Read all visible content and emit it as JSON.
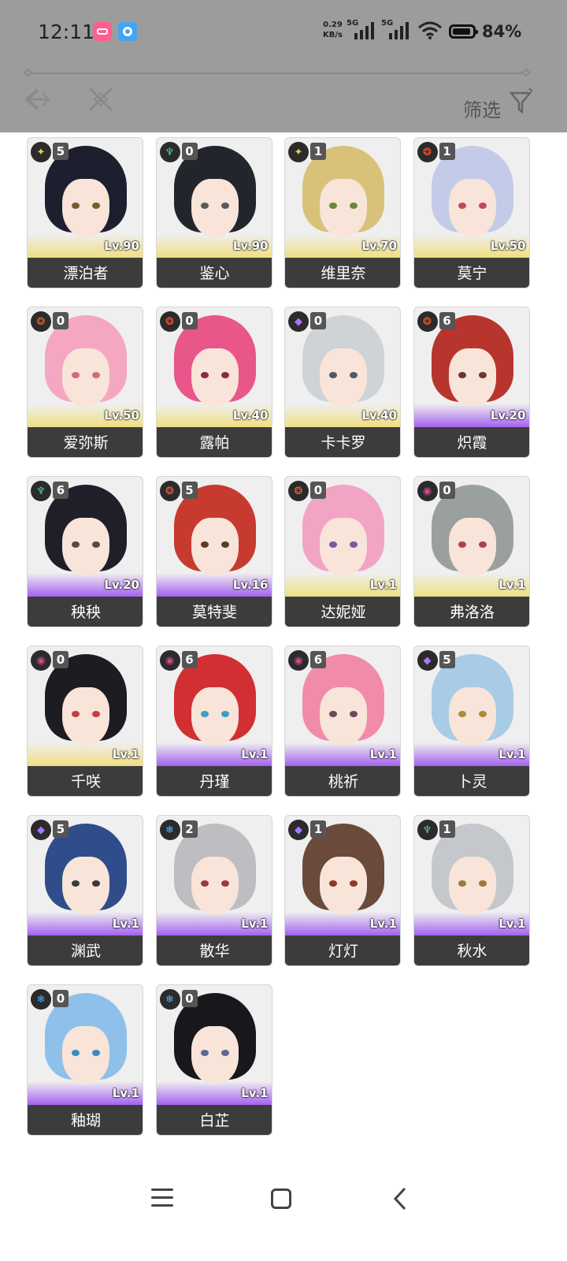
{
  "status_bar": {
    "time": "12:11",
    "net_speed_value": "0.29",
    "net_speed_unit": "KB/s",
    "sim1": "5G",
    "sim2": "5G",
    "battery": "84%"
  },
  "toolbar": {
    "filter_label": "筛选"
  },
  "colors": {
    "overlay": "#9c9c9c",
    "name_bar": "#3c3c3c",
    "rarity5": "#f0dc6e",
    "rarity4": "#a05af0"
  },
  "characters": [
    {
      "name": "漂泊者",
      "level": "Lv.90",
      "cons": "5",
      "element": "spectro-icon",
      "rarity": 5,
      "hair": "#1d1f2e",
      "eye": "#7a5a30"
    },
    {
      "name": "鉴心",
      "level": "Lv.90",
      "cons": "0",
      "element": "aero-icon",
      "rarity": 5,
      "hair": "#23252c",
      "eye": "#5a5a5a"
    },
    {
      "name": "维里奈",
      "level": "Lv.70",
      "cons": "1",
      "element": "spectro-icon",
      "rarity": 5,
      "hair": "#d8c27a",
      "eye": "#6a8a3a"
    },
    {
      "name": "莫宁",
      "level": "Lv.50",
      "cons": "1",
      "element": "fusion-icon",
      "rarity": 5,
      "hair": "#c4cbe8",
      "eye": "#c04a5a"
    },
    {
      "name": "爱弥斯",
      "level": "Lv.50",
      "cons": "0",
      "element": "fusion-icon",
      "rarity": 5,
      "hair": "#f5a6c0",
      "eye": "#d06a7a"
    },
    {
      "name": "露帕",
      "level": "Lv.40",
      "cons": "0",
      "element": "fusion-icon",
      "rarity": 5,
      "hair": "#e8568a",
      "eye": "#8a2a4a"
    },
    {
      "name": "卡卡罗",
      "level": "Lv.40",
      "cons": "0",
      "element": "electro-icon",
      "rarity": 5,
      "hair": "#cfd2d6",
      "eye": "#4a5a6a"
    },
    {
      "name": "炽霞",
      "level": "Lv.20",
      "cons": "6",
      "element": "fusion-icon",
      "rarity": 4,
      "hair": "#b8352e",
      "eye": "#6a3a2a"
    },
    {
      "name": "秧秧",
      "level": "Lv.20",
      "cons": "6",
      "element": "aero-icon",
      "rarity": 4,
      "hair": "#1f1f2a",
      "eye": "#5a4a3a"
    },
    {
      "name": "莫特斐",
      "level": "Lv.16",
      "cons": "5",
      "element": "fusion-icon",
      "rarity": 4,
      "hair": "#c63a30",
      "eye": "#5a3a2a"
    },
    {
      "name": "达妮娅",
      "level": "Lv.1",
      "cons": "0",
      "element": "fusion-icon",
      "rarity": 5,
      "hair": "#f2a4c4",
      "eye": "#7a5aa0"
    },
    {
      "name": "弗洛洛",
      "level": "Lv.1",
      "cons": "0",
      "element": "havoc-icon",
      "rarity": 5,
      "hair": "#9aa09e",
      "eye": "#b04050"
    },
    {
      "name": "千咲",
      "level": "Lv.1",
      "cons": "0",
      "element": "havoc-icon",
      "rarity": 5,
      "hair": "#1c1c22",
      "eye": "#c04040"
    },
    {
      "name": "丹瑾",
      "level": "Lv.1",
      "cons": "6",
      "element": "havoc-icon",
      "rarity": 4,
      "hair": "#d22f33",
      "eye": "#3aa0c0"
    },
    {
      "name": "桃祈",
      "level": "Lv.1",
      "cons": "6",
      "element": "havoc-icon",
      "rarity": 4,
      "hair": "#f08ca8",
      "eye": "#6a4a5a"
    },
    {
      "name": "卜灵",
      "level": "Lv.1",
      "cons": "5",
      "element": "electro-icon",
      "rarity": 4,
      "hair": "#a8cbe6",
      "eye": "#b08a3a"
    },
    {
      "name": "渊武",
      "level": "Lv.1",
      "cons": "5",
      "element": "electro-icon",
      "rarity": 4,
      "hair": "#2f4d8a",
      "eye": "#3a3a3a"
    },
    {
      "name": "散华",
      "level": "Lv.1",
      "cons": "2",
      "element": "glacio-icon",
      "rarity": 4,
      "hair": "#bdbdc2",
      "eye": "#9a3a3a"
    },
    {
      "name": "灯灯",
      "level": "Lv.1",
      "cons": "1",
      "element": "electro-icon",
      "rarity": 4,
      "hair": "#6a4a3a",
      "eye": "#8a3a2a"
    },
    {
      "name": "秋水",
      "level": "Lv.1",
      "cons": "1",
      "element": "aero-icon",
      "rarity": 4,
      "hair": "#c4c8cc",
      "eye": "#9a7a3a"
    },
    {
      "name": "釉瑚",
      "level": "Lv.1",
      "cons": "0",
      "element": "glacio-icon",
      "rarity": 4,
      "hair": "#8ec0ea",
      "eye": "#3a8ac0"
    },
    {
      "name": "白芷",
      "level": "Lv.1",
      "cons": "0",
      "element": "glacio-icon",
      "rarity": 4,
      "hair": "#17171c",
      "eye": "#5a6a8a"
    }
  ]
}
